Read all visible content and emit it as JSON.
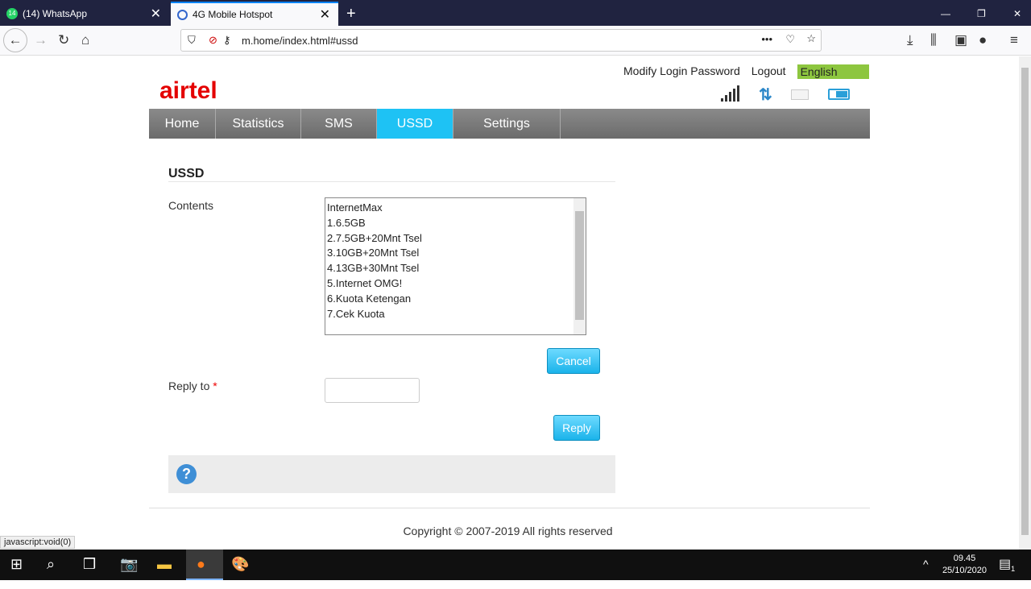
{
  "browser": {
    "tabs": [
      {
        "label": "(14) WhatsApp",
        "badge": "14"
      },
      {
        "label": "4G Mobile Hotspot"
      }
    ],
    "url": "m.home/index.html#ussd",
    "status_text": "javascript:void(0)"
  },
  "header": {
    "logo": "airtel",
    "modify_password": "Modify Login Password",
    "logout": "Logout",
    "language": "English"
  },
  "menu": [
    {
      "label": "Home"
    },
    {
      "label": "Statistics"
    },
    {
      "label": "SMS"
    },
    {
      "label": "USSD",
      "active": true
    },
    {
      "label": "Settings"
    }
  ],
  "ussd": {
    "title": "USSD",
    "contents_label": "Contents",
    "contents": [
      "InternetMax",
      "1.6.5GB",
      "2.7.5GB+20Mnt Tsel",
      "3.10GB+20Mnt Tsel",
      "4.13GB+30Mnt Tsel",
      "5.Internet OMG!",
      "6.Kuota Ketengan",
      "7.Cek Kuota"
    ],
    "cancel": "Cancel",
    "reply_label": "Reply to",
    "required": "*",
    "reply_value": "",
    "reply_button": "Reply"
  },
  "footer": {
    "copyright": "Copyright © 2007-2019 All rights reserved"
  },
  "taskbar": {
    "time": "09.45",
    "date": "25/10/2020",
    "notifications": "1"
  },
  "colors": {
    "accent": "#1ec2f4",
    "language_bg": "#8dc63f",
    "brand": "#e40000"
  }
}
